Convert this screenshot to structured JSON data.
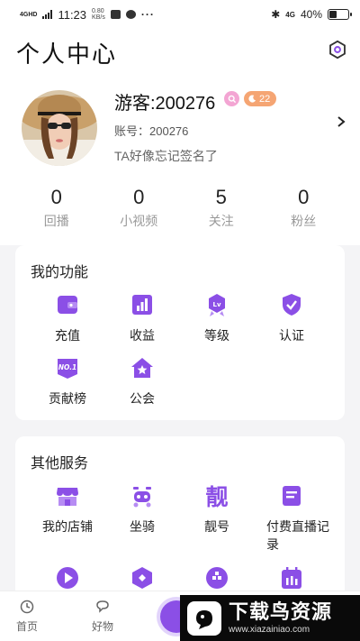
{
  "status_bar": {
    "network": "4GHD",
    "time": "11:23",
    "speed_value": "0.80",
    "speed_unit": "KB/s",
    "more": "···",
    "right_network": "4G",
    "battery": "40%",
    "battery_level": 0.4
  },
  "header": {
    "title": "个人中心"
  },
  "profile": {
    "username": "游客:200276",
    "level_badge": "22",
    "account_label": "账号：",
    "account_id": "200276",
    "signature": "TA好像忘记签名了"
  },
  "stats": [
    {
      "value": "0",
      "label": "回播"
    },
    {
      "value": "0",
      "label": "小视频"
    },
    {
      "value": "5",
      "label": "关注"
    },
    {
      "value": "0",
      "label": "粉丝"
    }
  ],
  "functions": {
    "title": "我的功能",
    "items": [
      {
        "label": "充值",
        "icon": "wallet-icon"
      },
      {
        "label": "收益",
        "icon": "earnings-icon"
      },
      {
        "label": "等级",
        "icon": "level-icon"
      },
      {
        "label": "认证",
        "icon": "verify-icon"
      },
      {
        "label": "贡献榜",
        "icon": "ranking-icon"
      },
      {
        "label": "公会",
        "icon": "guild-icon"
      }
    ]
  },
  "services": {
    "title": "其他服务",
    "items": [
      {
        "label": "我的店铺",
        "icon": "shop-icon"
      },
      {
        "label": "坐骑",
        "icon": "mount-icon"
      },
      {
        "label": "靓号",
        "icon": "vip-number-icon",
        "glyph": "靓"
      },
      {
        "label": "付费直播记录",
        "icon": "paid-live-record-icon"
      }
    ]
  },
  "bottom_nav": {
    "home": "首页",
    "goods": "好物"
  },
  "watermark": {
    "title": "下载鸟资源",
    "url": "www.xiazainiao.com"
  },
  "colors": {
    "accent": "#8b4fe6",
    "accent_light": "#b68cf3",
    "badge_pink": "#f3a5d3",
    "badge_orange": "#f5a573"
  }
}
